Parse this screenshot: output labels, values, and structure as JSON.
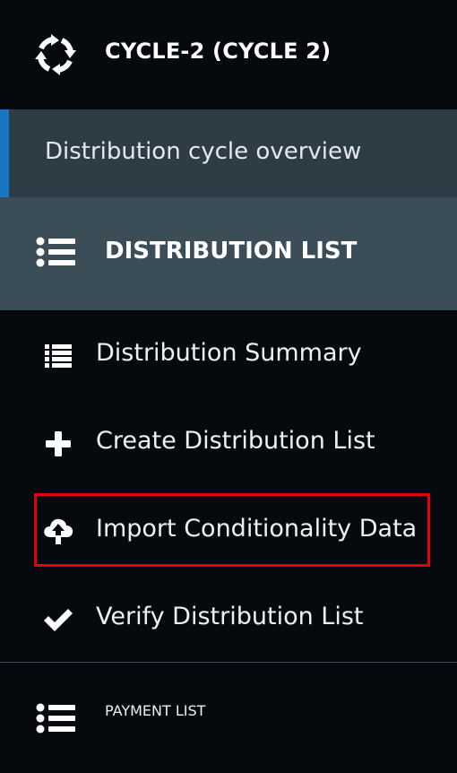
{
  "cycle": {
    "title": "CYCLE-2 (CYCLE 2)",
    "icon": "cycle-refresh-icon"
  },
  "overview": {
    "label": "Distribution cycle overview",
    "accent_color": "#1a76c4"
  },
  "distribution_section": {
    "title": "DISTRIBUTION LIST",
    "icon": "list-icon",
    "items": [
      {
        "label": "Distribution Summary",
        "icon": "list-summary-icon"
      },
      {
        "label": "Create Distribution List",
        "icon": "plus-icon"
      },
      {
        "label": "Import Conditionality Data",
        "icon": "cloud-upload-icon",
        "highlighted": true
      },
      {
        "label": "Verify Distribution List",
        "icon": "check-icon"
      }
    ]
  },
  "payment_section": {
    "title": "PAYMENT LIST",
    "icon": "list-icon"
  },
  "colors": {
    "background": "#060a0f",
    "overview_bg": "#2e3c45",
    "section_bg": "#3b4e58",
    "highlight_border": "#e5000c"
  }
}
